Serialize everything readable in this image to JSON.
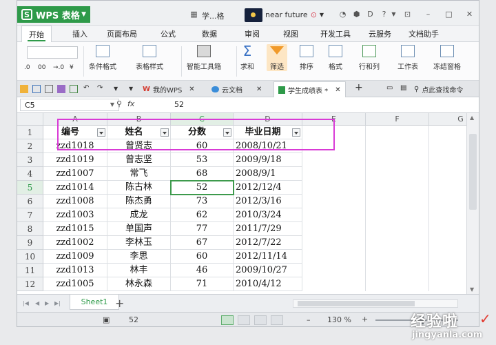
{
  "app": {
    "title": "WPS 表格",
    "logo_letter": "S",
    "doc_short": "学...格",
    "user": "near future"
  },
  "menu_tabs": [
    "开始",
    "插入",
    "页面布局",
    "公式",
    "数据",
    "审阅",
    "视图",
    "开发工具",
    "云服务",
    "文档助手"
  ],
  "ribbon": {
    "small_format": [
      ".0",
      "00",
      "→.0",
      "¥"
    ],
    "conditional_format": "条件格式",
    "table_style": "表格样式",
    "smart_toolbox": "智能工具箱",
    "sum": "求和",
    "filter": "筛选",
    "sort": "排序",
    "format": "格式",
    "rows_cols": "行和列",
    "worksheet": "工作表",
    "freeze": "冻结窗格"
  },
  "doc_tabs": {
    "my_wps": "我的WPS",
    "cloud_doc": "云文档",
    "active": "学生成绩表 *",
    "find_command": "点此查找命令"
  },
  "formula_bar": {
    "cell_ref": "C5",
    "fx": "fx",
    "value": "52"
  },
  "columns": [
    "A",
    "B",
    "C",
    "D",
    "E",
    "F",
    "G"
  ],
  "rows": [
    "1",
    "2",
    "3",
    "4",
    "5",
    "6",
    "7",
    "8",
    "9",
    "10",
    "11",
    "12"
  ],
  "table": {
    "headers": [
      "编号",
      "姓名",
      "分数",
      "毕业日期"
    ],
    "data": [
      [
        "zzd1018",
        "曾贤志",
        "60",
        "2008/10/21"
      ],
      [
        "zzd1019",
        "曾志坚",
        "53",
        "2009/9/18"
      ],
      [
        "zzd1007",
        "常飞",
        "68",
        "2008/9/1"
      ],
      [
        "zzd1014",
        "陈古林",
        "52",
        "2012/12/4"
      ],
      [
        "zzd1008",
        "陈杰勇",
        "73",
        "2012/3/16"
      ],
      [
        "zzd1003",
        "成龙",
        "62",
        "2010/3/24"
      ],
      [
        "zzd1015",
        "单国声",
        "77",
        "2011/7/29"
      ],
      [
        "zzd1002",
        "李林玉",
        "67",
        "2012/7/22"
      ],
      [
        "zzd1009",
        "李思",
        "60",
        "2012/11/14"
      ],
      [
        "zzd1013",
        "林丰",
        "46",
        "2009/10/27"
      ],
      [
        "zzd1005",
        "林永森",
        "71",
        "2010/4/12"
      ]
    ]
  },
  "sheet_tab": "Sheet1",
  "status": {
    "value": "52",
    "zoom": "130 %"
  },
  "watermark": {
    "line1": "经验啦",
    "line2": "jingyanla.com",
    "tick": "✓"
  },
  "colors": {
    "accent": "#2e9a49",
    "highlight": "#d93ad6",
    "filter_icon": "#f19a2a"
  }
}
